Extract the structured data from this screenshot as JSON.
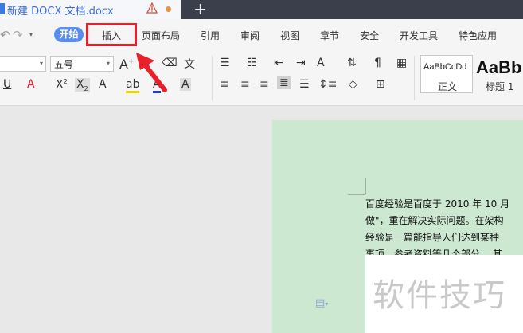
{
  "titlebar": {
    "doc_title": "新建 DOCX 文档.docx",
    "new_tab": "+"
  },
  "menu": {
    "items": [
      "开始",
      "插入",
      "页面布局",
      "引用",
      "审阅",
      "视图",
      "章节",
      "安全",
      "开发工具",
      "特色应用"
    ],
    "active": "开始",
    "highlighted": "插入"
  },
  "toolbar": {
    "font_size": "五号",
    "styles": [
      {
        "preview": "AaBbCcDd",
        "label": "正文"
      },
      {
        "preview": "AaBb",
        "label": "标题 1"
      }
    ]
  },
  "document": {
    "lines": [
      "百度经验是百度于 2010 年 10 月",
      "做\"，重在解决实际问题。在架构",
      "经验是一篇能指导人们达到某种",
      "事项、参考资料等几个部分。 其"
    ]
  },
  "watermark": "软件技巧",
  "colors": {
    "accent": "#5b8def",
    "highlight_box": "#e8202a",
    "page_bg": "#cde8d1",
    "titlebar_bg": "#3a3f4b"
  }
}
